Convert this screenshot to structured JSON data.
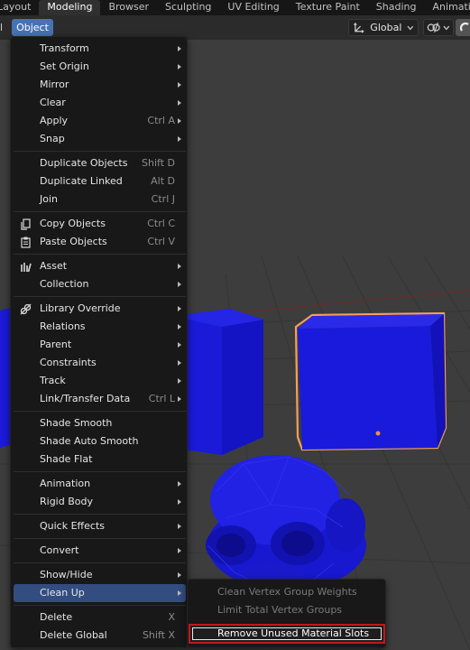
{
  "workspace_tabs": [
    "Layout",
    "Modeling",
    "Browser",
    "Sculpting",
    "UV Editing",
    "Texture Paint",
    "Shading",
    "Animati"
  ],
  "active_tab_index": 1,
  "viewport_header": {
    "object_menu_label": "Object",
    "transform_orientation": "Global",
    "left_stub": "l"
  },
  "object_menu": {
    "items": [
      {
        "label": "Transform",
        "submenu": true
      },
      {
        "label": "Set Origin",
        "submenu": true
      },
      {
        "label": "Mirror",
        "submenu": true
      },
      {
        "label": "Clear",
        "submenu": true
      },
      {
        "label": "Apply",
        "shortcut": "Ctrl A",
        "submenu": true
      },
      {
        "label": "Snap",
        "submenu": true
      },
      {
        "label": "Duplicate Objects",
        "shortcut": "Shift D"
      },
      {
        "label": "Duplicate Linked",
        "shortcut": "Alt D"
      },
      {
        "label": "Join",
        "shortcut": "Ctrl J"
      },
      {
        "label": "Copy Objects",
        "shortcut": "Ctrl C",
        "icon": "copy-icon"
      },
      {
        "label": "Paste Objects",
        "shortcut": "Ctrl V",
        "icon": "paste-icon"
      },
      {
        "label": "Asset",
        "submenu": true,
        "icon": "asset-icon"
      },
      {
        "label": "Collection",
        "submenu": true
      },
      {
        "label": "Library Override",
        "submenu": true,
        "icon": "library-override-icon"
      },
      {
        "label": "Relations",
        "submenu": true
      },
      {
        "label": "Parent",
        "submenu": true
      },
      {
        "label": "Constraints",
        "submenu": true
      },
      {
        "label": "Track",
        "submenu": true
      },
      {
        "label": "Link/Transfer Data",
        "shortcut": "Ctrl L",
        "submenu": true
      },
      {
        "label": "Shade Smooth"
      },
      {
        "label": "Shade Auto Smooth"
      },
      {
        "label": "Shade Flat"
      },
      {
        "label": "Animation",
        "submenu": true
      },
      {
        "label": "Rigid Body",
        "submenu": true
      },
      {
        "label": "Quick Effects",
        "submenu": true
      },
      {
        "label": "Convert",
        "submenu": true
      },
      {
        "label": "Show/Hide",
        "submenu": true
      },
      {
        "label": "Clean Up",
        "submenu": true,
        "highlighted": true
      },
      {
        "label": "Delete",
        "shortcut": "X"
      },
      {
        "label": "Delete Global",
        "shortcut": "Shift X"
      }
    ]
  },
  "cleanup_submenu": {
    "items": [
      {
        "label": "Clean Vertex Group Weights",
        "enabled": false
      },
      {
        "label": "Limit Total Vertex Groups",
        "enabled": false
      },
      {
        "label": "Remove Unused Material Slots",
        "enabled": true,
        "highlighted": true
      }
    ]
  },
  "colors": {
    "accent": "#4772b3",
    "menu_highlight": "#334d80",
    "selection_outline": "#f5a05a",
    "target_box": "#c0181e",
    "object_blue": "#1a1adc"
  }
}
